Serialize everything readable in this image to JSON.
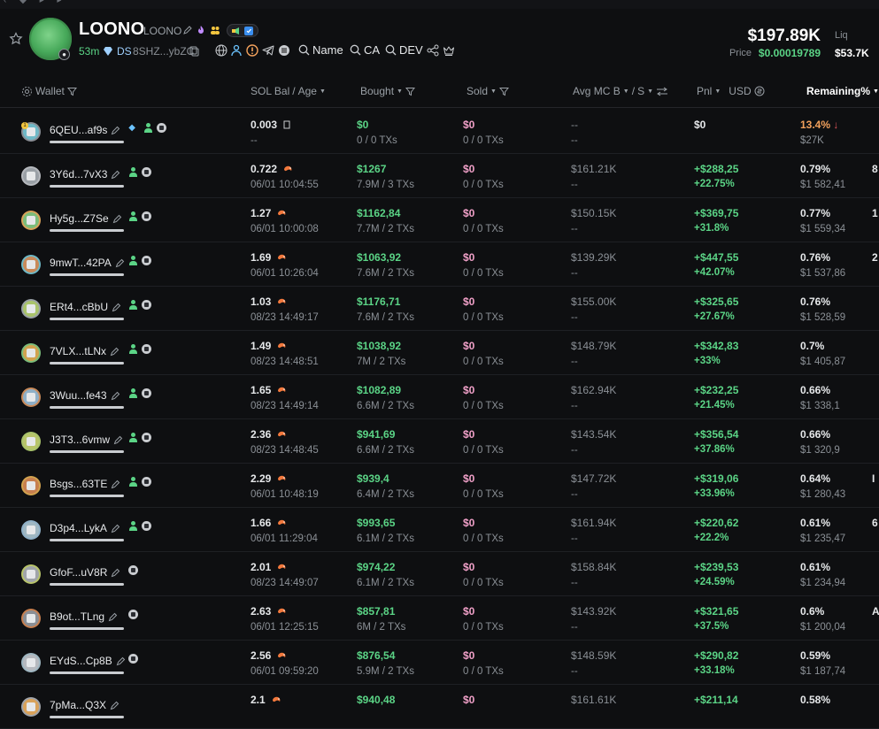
{
  "token": {
    "name": "LOONO",
    "ticker": "LOONO",
    "age": "53m",
    "ds_label": "DS",
    "contract_short": "8SHZ...ybZC",
    "links": [
      "Name",
      "CA",
      "DEV"
    ],
    "market_cap": "$197.89K",
    "price_label": "Price",
    "price": "$0.00019789",
    "liq_label": "Liq",
    "liq": "$53.7K"
  },
  "columns": {
    "wallet": "Wallet",
    "sol_bal": "SOL Bal",
    "age_sep": "/",
    "age": "Age",
    "bought": "Bought",
    "sold": "Sold",
    "avg_mc": "Avg MC B",
    "avg_sep": "/",
    "avg_s": "S",
    "pnl": "Pnl",
    "usd": "USD",
    "remaining": "Remaining%"
  },
  "rows": [
    {
      "wallet": "6QEU...af9s",
      "sol": "0.003",
      "sol_icon": "square",
      "time": "--",
      "bought": "$0",
      "bought_sub": "0 / 0 TXs",
      "sold": "$0",
      "sold_sub": "0 / 0 TXs",
      "avg": "--",
      "avg_sub": "--",
      "pnl": "$0",
      "pnl_pct": "",
      "rem": "13.4%",
      "rem_arrow": "↓",
      "rem_usd": "$27K",
      "edge": "",
      "tags": [
        "fish",
        "user",
        "dot"
      ],
      "rank": "1"
    },
    {
      "wallet": "3Y6d...7vX3",
      "sol": "0.722",
      "sol_icon": "shrimp",
      "time": "06/01 10:04:55",
      "bought": "$1267",
      "bought_sub": "7.9M / 3 TXs",
      "sold": "$0",
      "sold_sub": "0 / 0 TXs",
      "avg": "$161.21K",
      "avg_sub": "--",
      "pnl": "+$288,25",
      "pnl_pct": "+22.75%",
      "rem": "0.79%",
      "rem_arrow": "",
      "rem_usd": "$1 582,41",
      "edge": "8",
      "tags": [
        "user",
        "dot"
      ],
      "rank": ""
    },
    {
      "wallet": "Hy5g...Z7Se",
      "sol": "1.27",
      "sol_icon": "shrimp",
      "time": "06/01 10:00:08",
      "bought": "$1162,84",
      "bought_sub": "7.7M / 2 TXs",
      "sold": "$0",
      "sold_sub": "0 / 0 TXs",
      "avg": "$150.15K",
      "avg_sub": "--",
      "pnl": "+$369,75",
      "pnl_pct": "+31.8%",
      "rem": "0.77%",
      "rem_arrow": "",
      "rem_usd": "$1 559,34",
      "edge": "1",
      "tags": [
        "user",
        "dot"
      ],
      "rank": ""
    },
    {
      "wallet": "9mwT...42PA",
      "sol": "1.69",
      "sol_icon": "shrimp",
      "time": "06/01 10:26:04",
      "bought": "$1063,92",
      "bought_sub": "7.6M / 2 TXs",
      "sold": "$0",
      "sold_sub": "0 / 0 TXs",
      "avg": "$139.29K",
      "avg_sub": "--",
      "pnl": "+$447,55",
      "pnl_pct": "+42.07%",
      "rem": "0.76%",
      "rem_arrow": "",
      "rem_usd": "$1 537,86",
      "edge": "2",
      "tags": [
        "user",
        "dot"
      ],
      "rank": ""
    },
    {
      "wallet": "ERt4...cBbU",
      "sol": "1.03",
      "sol_icon": "shrimp",
      "time": "08/23 14:49:17",
      "bought": "$1176,71",
      "bought_sub": "7.6M / 2 TXs",
      "sold": "$0",
      "sold_sub": "0 / 0 TXs",
      "avg": "$155.00K",
      "avg_sub": "--",
      "pnl": "+$325,65",
      "pnl_pct": "+27.67%",
      "rem": "0.76%",
      "rem_arrow": "",
      "rem_usd": "$1 528,59",
      "edge": "",
      "tags": [
        "user",
        "dot"
      ],
      "rank": ""
    },
    {
      "wallet": "7VLX...tLNx",
      "sol": "1.49",
      "sol_icon": "shrimp",
      "time": "08/23 14:48:51",
      "bought": "$1038,92",
      "bought_sub": "7M / 2 TXs",
      "sold": "$0",
      "sold_sub": "0 / 0 TXs",
      "avg": "$148.79K",
      "avg_sub": "--",
      "pnl": "+$342,83",
      "pnl_pct": "+33%",
      "rem": "0.7%",
      "rem_arrow": "",
      "rem_usd": "$1 405,87",
      "edge": "",
      "tags": [
        "user",
        "dot"
      ],
      "rank": ""
    },
    {
      "wallet": "3Wuu...fe43",
      "sol": "1.65",
      "sol_icon": "shrimp",
      "time": "08/23 14:49:14",
      "bought": "$1082,89",
      "bought_sub": "6.6M / 2 TXs",
      "sold": "$0",
      "sold_sub": "0 / 0 TXs",
      "avg": "$162.94K",
      "avg_sub": "--",
      "pnl": "+$232,25",
      "pnl_pct": "+21.45%",
      "rem": "0.66%",
      "rem_arrow": "",
      "rem_usd": "$1 338,1",
      "edge": "",
      "tags": [
        "user",
        "dot"
      ],
      "rank": ""
    },
    {
      "wallet": "J3T3...6vmw",
      "sol": "2.36",
      "sol_icon": "shrimp",
      "time": "08/23 14:48:45",
      "bought": "$941,69",
      "bought_sub": "6.6M / 2 TXs",
      "sold": "$0",
      "sold_sub": "0 / 0 TXs",
      "avg": "$143.54K",
      "avg_sub": "--",
      "pnl": "+$356,54",
      "pnl_pct": "+37.86%",
      "rem": "0.66%",
      "rem_arrow": "",
      "rem_usd": "$1 320,9",
      "edge": "",
      "tags": [
        "user",
        "dot"
      ],
      "rank": ""
    },
    {
      "wallet": "Bsgs...63TE",
      "sol": "2.29",
      "sol_icon": "shrimp",
      "time": "06/01 10:48:19",
      "bought": "$939,4",
      "bought_sub": "6.4M / 2 TXs",
      "sold": "$0",
      "sold_sub": "0 / 0 TXs",
      "avg": "$147.72K",
      "avg_sub": "--",
      "pnl": "+$319,06",
      "pnl_pct": "+33.96%",
      "rem": "0.64%",
      "rem_arrow": "",
      "rem_usd": "$1 280,43",
      "edge": "I",
      "tags": [
        "user",
        "dot"
      ],
      "rank": ""
    },
    {
      "wallet": "D3p4...LykA",
      "sol": "1.66",
      "sol_icon": "shrimp",
      "time": "06/01 11:29:04",
      "bought": "$993,65",
      "bought_sub": "6.1M / 2 TXs",
      "sold": "$0",
      "sold_sub": "0 / 0 TXs",
      "avg": "$161.94K",
      "avg_sub": "--",
      "pnl": "+$220,62",
      "pnl_pct": "+22.2%",
      "rem": "0.61%",
      "rem_arrow": "",
      "rem_usd": "$1 235,47",
      "edge": "6",
      "tags": [
        "user",
        "dot"
      ],
      "rank": ""
    },
    {
      "wallet": "GfoF...uV8R",
      "sol": "2.01",
      "sol_icon": "shrimp",
      "time": "08/23 14:49:07",
      "bought": "$974,22",
      "bought_sub": "6.1M / 2 TXs",
      "sold": "$0",
      "sold_sub": "0 / 0 TXs",
      "avg": "$158.84K",
      "avg_sub": "--",
      "pnl": "+$239,53",
      "pnl_pct": "+24.59%",
      "rem": "0.61%",
      "rem_arrow": "",
      "rem_usd": "$1 234,94",
      "edge": "",
      "tags": [
        "dot"
      ],
      "rank": ""
    },
    {
      "wallet": "B9ot...TLng",
      "sol": "2.63",
      "sol_icon": "shrimp",
      "time": "06/01 12:25:15",
      "bought": "$857,81",
      "bought_sub": "6M / 2 TXs",
      "sold": "$0",
      "sold_sub": "0 / 0 TXs",
      "avg": "$143.92K",
      "avg_sub": "--",
      "pnl": "+$321,65",
      "pnl_pct": "+37.5%",
      "rem": "0.6%",
      "rem_arrow": "",
      "rem_usd": "$1 200,04",
      "edge": "A",
      "tags": [
        "dot"
      ],
      "rank": ""
    },
    {
      "wallet": "EYdS...Cp8B",
      "sol": "2.56",
      "sol_icon": "shrimp",
      "time": "06/01 09:59:20",
      "bought": "$876,54",
      "bought_sub": "5.9M / 2 TXs",
      "sold": "$0",
      "sold_sub": "0 / 0 TXs",
      "avg": "$148.59K",
      "avg_sub": "--",
      "pnl": "+$290,82",
      "pnl_pct": "+33.18%",
      "rem": "0.59%",
      "rem_arrow": "",
      "rem_usd": "$1 187,74",
      "edge": "",
      "tags": [
        "dot"
      ],
      "rank": ""
    },
    {
      "wallet": "7pMa...Q3X",
      "sol": "2.1",
      "sol_icon": "shrimp",
      "time": "",
      "bought": "$940,48",
      "bought_sub": "",
      "sold": "$0",
      "sold_sub": "",
      "avg": "$161.61K",
      "avg_sub": "",
      "pnl": "+$211,14",
      "pnl_pct": "",
      "rem": "0.58%",
      "rem_arrow": "",
      "rem_usd": "",
      "edge": "",
      "tags": [],
      "rank": ""
    }
  ],
  "colors": {
    "green": "#5bd486",
    "pink": "#f0a0c8",
    "orange": "#f2a15c",
    "bg": "#0e0f11"
  },
  "icons": [
    "star-icon",
    "edit-icon",
    "fire-icon",
    "users-icon",
    "globe-icon",
    "person-icon",
    "warning-icon",
    "telegram-icon",
    "search-icon",
    "share-icon",
    "crown-icon",
    "settings-icon",
    "filter-icon",
    "swap-icon",
    "shrimp-icon"
  ]
}
